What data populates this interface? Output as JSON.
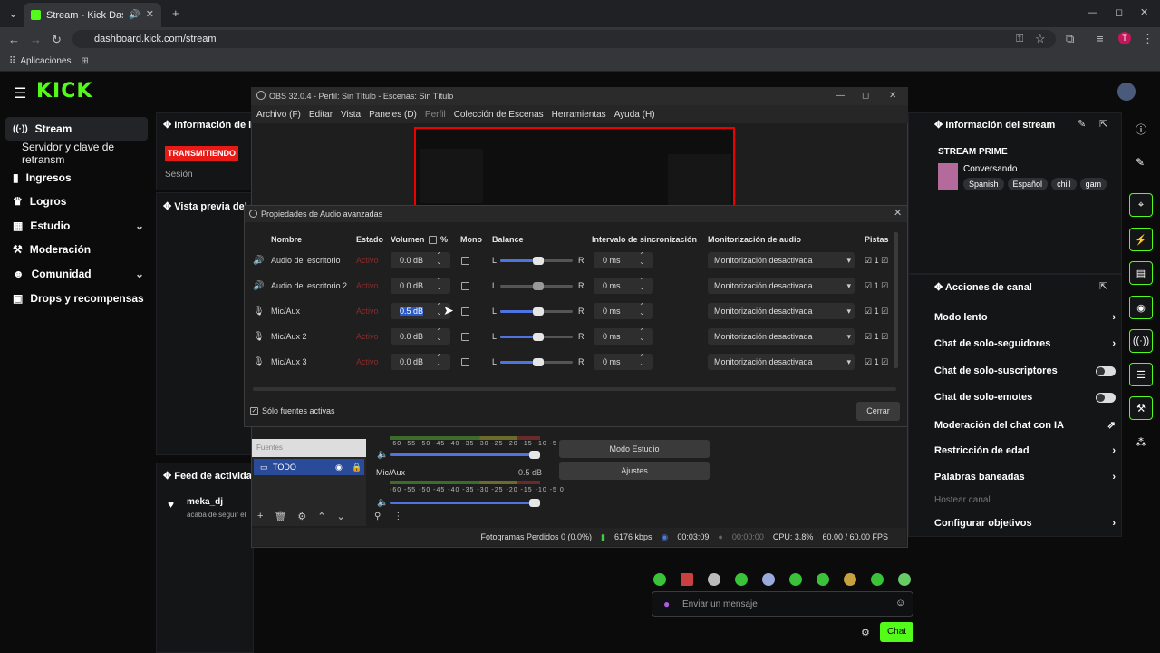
{
  "browser": {
    "tab_title": "Stream - Kick Dashboard",
    "url": "dashboard.kick.com/stream",
    "bookmark": "Aplicaciones",
    "profile_initial": "T"
  },
  "kick": {
    "logo": "KICK",
    "sidebar": [
      {
        "label": "Stream",
        "icon": "radio-icon"
      },
      {
        "label": "Servidor y clave de retransm",
        "icon": ""
      },
      {
        "label": "Ingresos",
        "icon": "chart-icon"
      },
      {
        "label": "Logros",
        "icon": "trophy-icon"
      },
      {
        "label": "Estudio",
        "icon": "studio-icon"
      },
      {
        "label": "Moderación",
        "icon": "wrench-icon"
      },
      {
        "label": "Comunidad",
        "icon": "community-icon"
      },
      {
        "label": "Drops y recompensas",
        "icon": "gift-icon"
      }
    ],
    "session_panel": {
      "title": "Información de la s",
      "badge": "TRANSMITIENDO",
      "label": "Sesión"
    },
    "preview_title": "Vista previa del st",
    "activity": {
      "title": "Feed de actividad",
      "user": "meka_dj",
      "text": "acaba de seguir el"
    },
    "stream_info": {
      "title": "Información del stream",
      "name": "STREAM PRIME",
      "category": "Conversando",
      "tags": [
        "Spanish",
        "Español",
        "chill",
        "gam"
      ]
    },
    "channel_actions": {
      "title": "Acciones de canal",
      "items": [
        "Modo lento",
        "Chat de solo-seguidores",
        "Chat de solo-suscriptores",
        "Chat de solo-emotes",
        "Moderación del chat con IA",
        "Restricción de edad",
        "Palabras baneadas",
        "Hostear canal",
        "Configurar objetivos"
      ]
    },
    "chat": {
      "placeholder": "Enviar un mensaje",
      "send": "Chat"
    }
  },
  "obs": {
    "title": "OBS 32.0.4 - Perfil: Sin Título - Escenas: Sin Título",
    "menu": [
      "Archivo (F)",
      "Editar",
      "Vista",
      "Paneles (D)",
      "Perfil",
      "Colección de Escenas",
      "Herramientas",
      "Ayuda (H)"
    ],
    "sources_label": "Fuentes",
    "source": "TODO",
    "mixer_source": "Mic/Aux",
    "mixer_db": "0.5 dB",
    "meter_ticks": "-60 -55 -50 -45 -40 -35 -30 -25 -20 -15 -10 -5 0",
    "studio_mode": "Modo Estudio",
    "settings": "Ajustes",
    "status": {
      "frames": "Fotogramas Perdidos 0 (0.0%)",
      "kbps": "6176 kbps",
      "time": "00:03:09",
      "rec": "00:00:00",
      "cpu": "CPU: 3.8%",
      "fps": "60.00 / 60.00 FPS"
    }
  },
  "dialog": {
    "title": "Propiedades de Audio avanzadas",
    "headers": {
      "name": "Nombre",
      "state": "Estado",
      "volume": "Volumen",
      "pct": "%",
      "mono": "Mono",
      "balance": "Balance",
      "sync": "Intervalo de sincronización",
      "monitor": "Monitorización de audio",
      "tracks": "Pistas"
    },
    "rows": [
      {
        "name": "Audio del escritorio",
        "state": "Activo",
        "volume": "0.0 dB",
        "sync": "0 ms",
        "monitor": "Monitorización desactivada",
        "track": "1"
      },
      {
        "name": "Audio del escritorio 2",
        "state": "Activo",
        "volume": "0.0 dB",
        "sync": "0 ms",
        "monitor": "Monitorización desactivada",
        "track": "1"
      },
      {
        "name": "Mic/Aux",
        "state": "Activo",
        "volume": "0.5 dB",
        "sync": "0 ms",
        "monitor": "Monitorización desactivada",
        "track": "1"
      },
      {
        "name": "Mic/Aux 2",
        "state": "Activo",
        "volume": "0.0 dB",
        "sync": "0 ms",
        "monitor": "Monitorización desactivada",
        "track": "1"
      },
      {
        "name": "Mic/Aux 3",
        "state": "Activo",
        "volume": "0.0 dB",
        "sync": "0 ms",
        "monitor": "Monitorización desactivada",
        "track": "1"
      }
    ],
    "balance_l": "L",
    "balance_r": "R",
    "active_only": "Sólo fuentes activas",
    "close": "Cerrar"
  }
}
